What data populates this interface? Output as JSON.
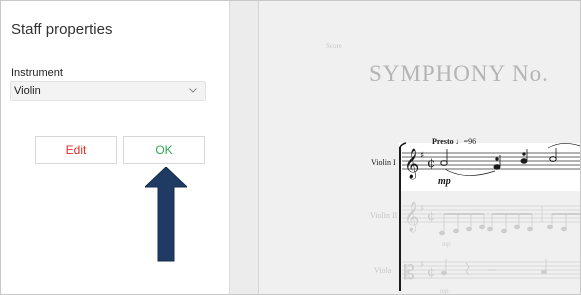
{
  "panel": {
    "title": "Staff properties",
    "instrument_label": "Instrument",
    "instrument_value": "Violin",
    "edit_label": "Edit",
    "ok_label": "OK"
  },
  "annotation": {
    "arrow_color": "#1f3b63",
    "arrow_icon": "arrow-up-icon"
  },
  "score": {
    "score_label": "Score",
    "title": "SYMPHONY No.",
    "tempo_text": "Presto",
    "tempo_value": "♩=96",
    "instruments": [
      "Violin I",
      "Violin II",
      "Viola"
    ],
    "dynamic": "mp"
  },
  "colors": {
    "edit": "#d9302a",
    "ok": "#34a853",
    "highlight_staff": "#ffffff"
  }
}
